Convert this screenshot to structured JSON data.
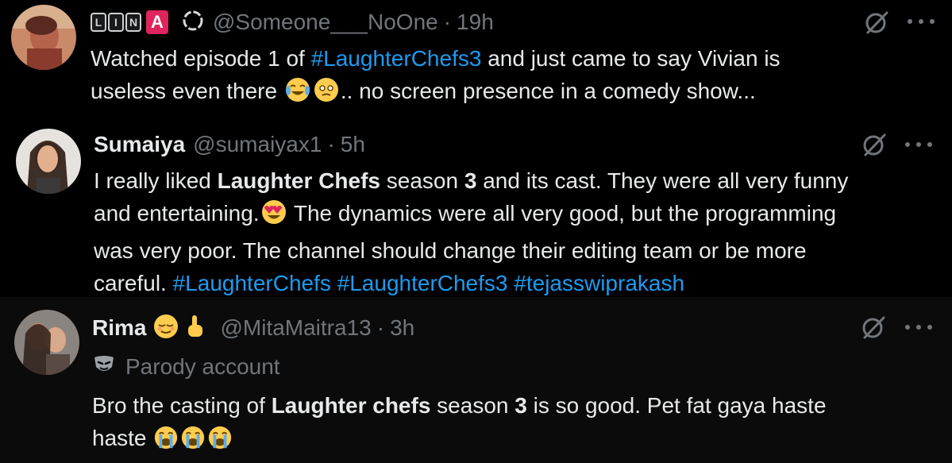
{
  "tweets": [
    {
      "name": "",
      "badge_letters": [
        "L",
        "I",
        "N",
        "A"
      ],
      "handle": "@Someone___NoOne",
      "separator": "·",
      "time": "19h",
      "text_line1_pre": "Watched episode 1 of ",
      "text_line1_tag": "#LaughterChefs3",
      "text_line1_post": " and just came to say Vivian is",
      "text_line2_pre": "useless even there ",
      "text_line2_post": ".. no screen presence in a comedy show..."
    },
    {
      "name": "Sumaiya",
      "handle": "@sumaiyax1",
      "separator": "·",
      "time": "5h",
      "l1_a": "I really liked ",
      "l1_b": "Laughter Chefs",
      "l1_c": " season ",
      "l1_d": "3",
      "l1_e": " and its cast. They were all very funny",
      "l2_a": "and entertaining.",
      "l2_b": " The dynamics were all very good, but the programming",
      "l3": "was very poor. The channel should change their editing team or be more",
      "l4_a": "careful.  ",
      "tags": [
        "#LaughterChefs",
        "#LaughterChefs3",
        "#tejasswiprakash"
      ]
    },
    {
      "name": "Rima",
      "handle": "@MitaMaitra13",
      "separator": "·",
      "time": "3h",
      "parody_label": "Parody account",
      "l1_a": "Bro the casting of ",
      "l1_b": "Laughter chefs",
      "l1_c": " season ",
      "l1_d": "3",
      "l1_e": " is so good. Pet fat gaya haste",
      "l2_a": "haste "
    }
  ],
  "colors": {
    "background": "#000000",
    "text": "#e7e9ea",
    "muted": "#71767b",
    "hashtag": "#1d9bf0"
  },
  "icons": [
    "grok-icon",
    "more-icon",
    "parody-mask-icon",
    "ring-icon"
  ]
}
